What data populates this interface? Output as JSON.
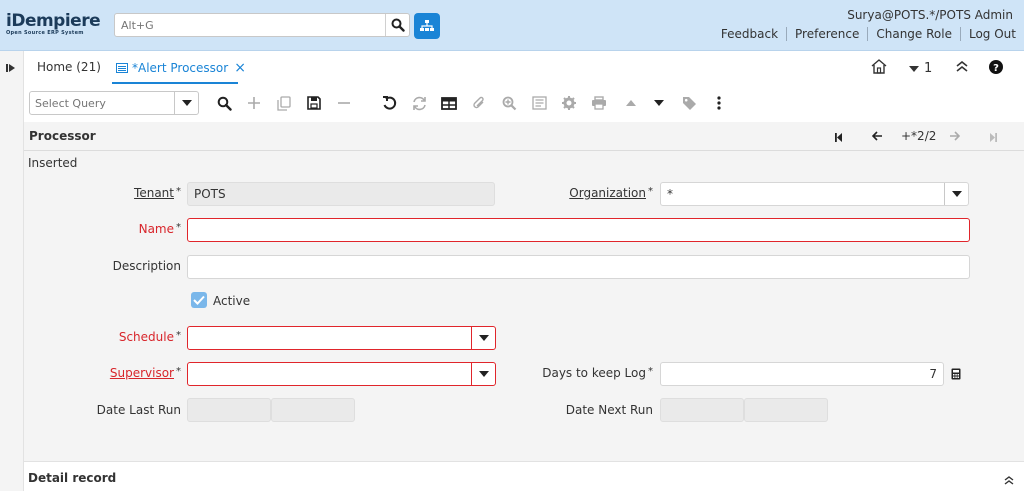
{
  "app": {
    "logo_main": "iDempiere",
    "logo_sub": "Open Source ERP System",
    "search_placeholder": "Alt+G",
    "user": "Surya@POTS.*/POTS Admin",
    "links": [
      "Feedback",
      "Preference",
      "Change Role",
      "Log Out"
    ]
  },
  "tabs": {
    "home": "Home (21)",
    "active": "*Alert Processor",
    "active_close": "×",
    "window_count": "1"
  },
  "toolbar": {
    "query_placeholder": "Select Query"
  },
  "panel": {
    "title": "Processor",
    "record_pos": "+*2/2"
  },
  "form": {
    "status": "Inserted",
    "tenant": {
      "label": "Tenant",
      "value": "POTS",
      "required": "*"
    },
    "organization": {
      "label": "Organization",
      "value": "*",
      "required": "*"
    },
    "name": {
      "label": "Name",
      "value": "",
      "required": "*"
    },
    "description": {
      "label": "Description",
      "value": ""
    },
    "active": {
      "label": "Active",
      "checked": true
    },
    "schedule": {
      "label": "Schedule",
      "value": "",
      "required": "*"
    },
    "supervisor": {
      "label": "Supervisor",
      "value": "",
      "required": "*"
    },
    "days_to_keep_log": {
      "label": "Days to keep Log",
      "value": "7",
      "required": "*"
    },
    "date_last_run": {
      "label": "Date Last Run"
    },
    "date_next_run": {
      "label": "Date Next Run"
    }
  },
  "detail": {
    "title": "Detail record"
  },
  "colors": {
    "header_bg": "#cfe4f7",
    "accent": "#1a84d6",
    "required": "#d8252b"
  }
}
